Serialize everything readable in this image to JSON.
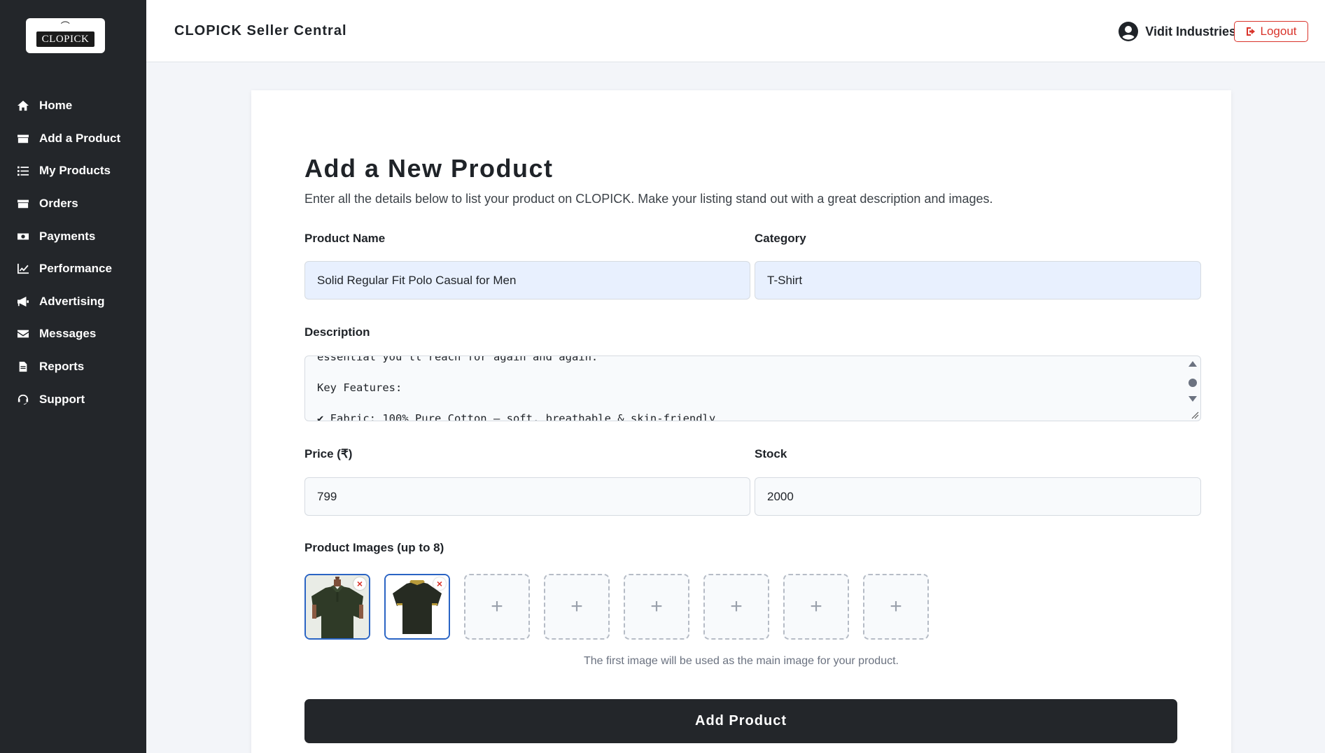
{
  "sidebar": {
    "logo_text": "CLOPICK",
    "items": [
      {
        "label": "Home",
        "icon": "home-icon"
      },
      {
        "label": "Add a Product",
        "icon": "box-icon"
      },
      {
        "label": "My Products",
        "icon": "list-icon"
      },
      {
        "label": "Orders",
        "icon": "box-icon"
      },
      {
        "label": "Payments",
        "icon": "money-icon"
      },
      {
        "label": "Performance",
        "icon": "chart-icon"
      },
      {
        "label": "Advertising",
        "icon": "megaphone-icon"
      },
      {
        "label": "Messages",
        "icon": "envelope-icon"
      },
      {
        "label": "Reports",
        "icon": "file-icon"
      },
      {
        "label": "Support",
        "icon": "headset-icon"
      }
    ]
  },
  "header": {
    "title": "CLOPICK Seller Central",
    "user_name": "Vidit Industries",
    "logout_label": "Logout"
  },
  "form": {
    "title": "Add a New Product",
    "subtitle": "Enter all the details below to list your product on CLOPICK. Make your listing stand out with a great description and images.",
    "product_name_label": "Product Name",
    "product_name_value": "Solid Regular Fit Polo Casual for Men",
    "category_label": "Category",
    "category_value": "T-Shirt",
    "description_label": "Description",
    "description_value": "essential you'll reach for again and again.\n\nKey Features:\n\n✔ Fabric: 100% Pure Cotton – soft, breathable & skin-friendly",
    "price_label": "Price (₹)",
    "price_value": "799",
    "stock_label": "Stock",
    "stock_value": "2000",
    "images_label": "Product Images (up to 8)",
    "images_hint": "The first image will be used as the main image for your product.",
    "submit_label": "Add Product"
  },
  "colors": {
    "sidebar_bg": "#23262a",
    "accent_blue": "#2a64c4",
    "logout_red": "#d9342b",
    "filled_input_bg": "#e8f0fe"
  }
}
